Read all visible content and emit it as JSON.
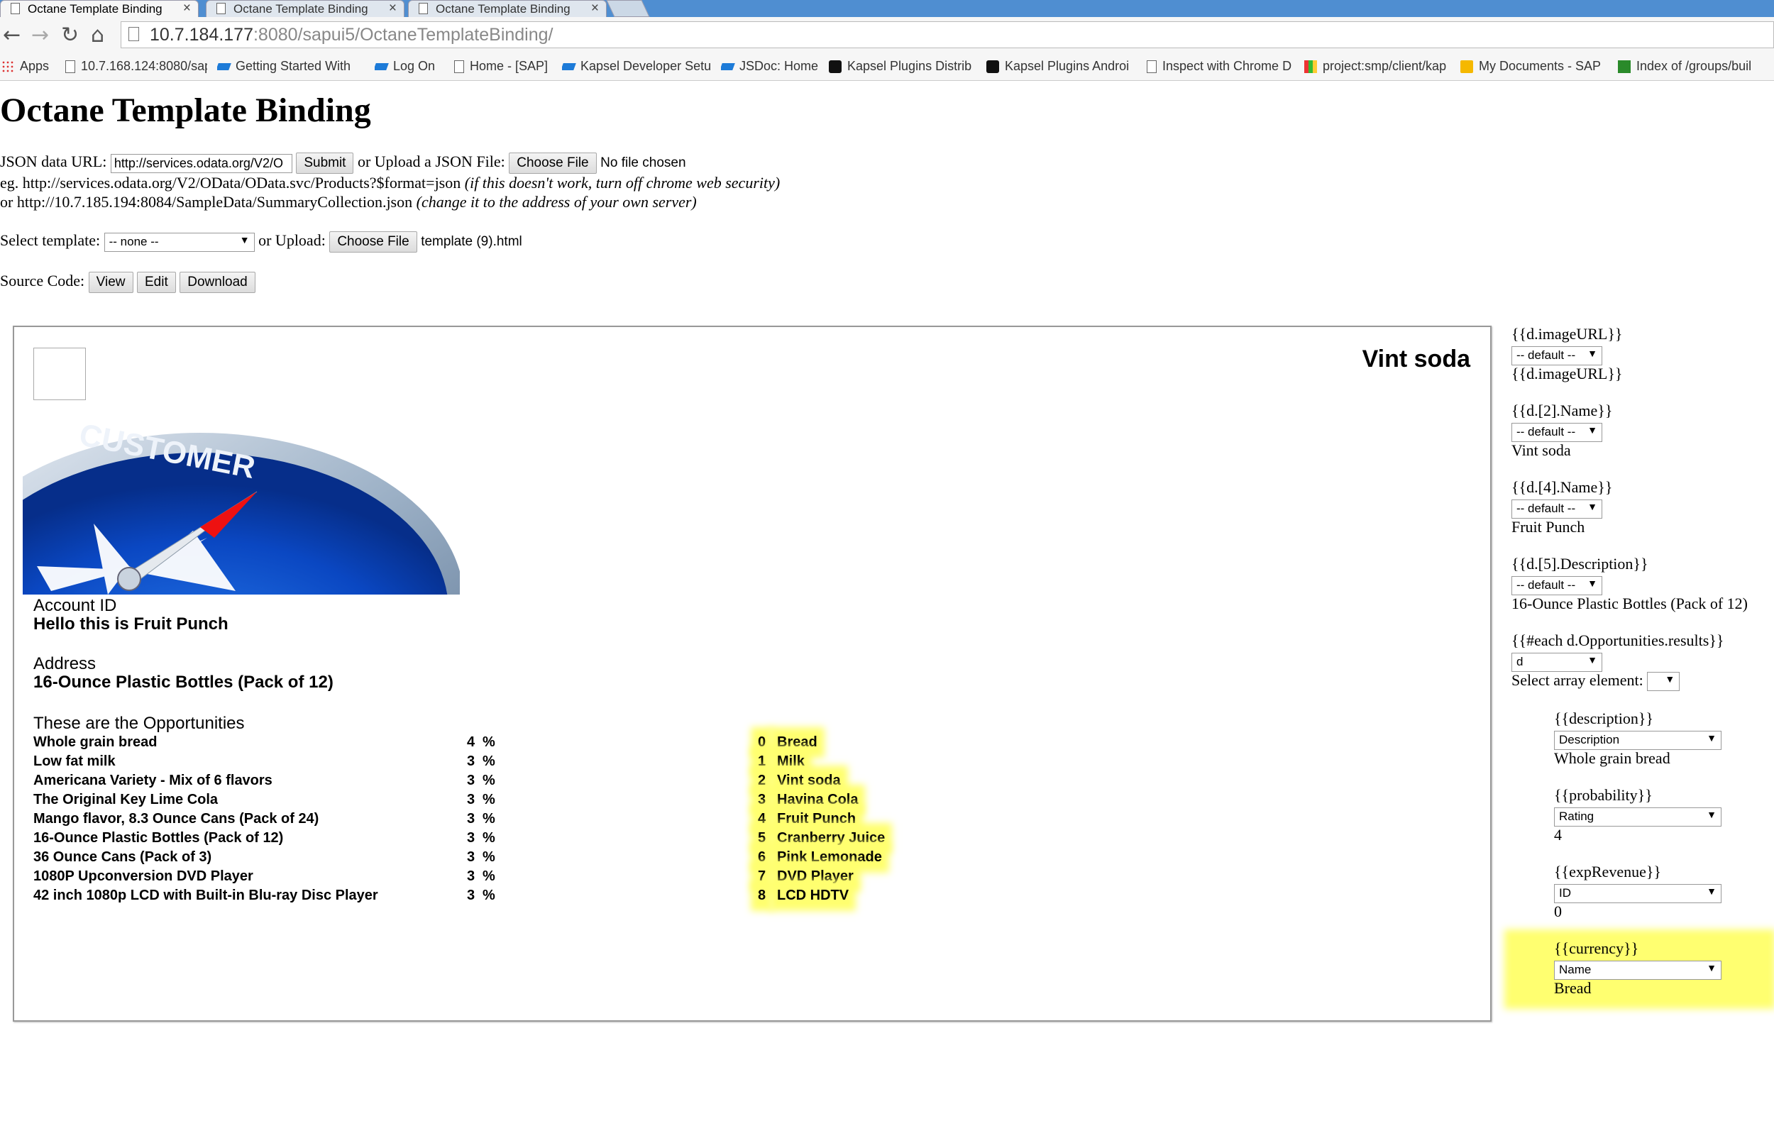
{
  "browser": {
    "tabs": [
      {
        "title": "Octane Template Binding",
        "close": "×"
      },
      {
        "title": "Octane Template Binding",
        "close": "×"
      },
      {
        "title": "Octane Template Binding",
        "close": "×"
      }
    ],
    "nav": {
      "back": "←",
      "forward": "→",
      "reload": "↻",
      "home": "⌂"
    },
    "url": {
      "host": "10.7.184.177",
      "rest": ":8080/sapui5/OctaneTemplateBinding/"
    },
    "bookmarks": [
      {
        "label": "Apps",
        "icon": "grid"
      },
      {
        "label": "10.7.168.124:8080/sap",
        "icon": "doc"
      },
      {
        "label": "Getting Started With",
        "icon": "sap"
      },
      {
        "label": "Log On",
        "icon": "sap"
      },
      {
        "label": "Home - [SAP]",
        "icon": "doc"
      },
      {
        "label": "Kapsel Developer Setu",
        "icon": "sap"
      },
      {
        "label": "JSDoc: Home",
        "icon": "sap"
      },
      {
        "label": "Kapsel Plugins Distrib",
        "icon": "git"
      },
      {
        "label": "Kapsel Plugins Androi",
        "icon": "git"
      },
      {
        "label": "Inspect with Chrome D",
        "icon": "doc"
      },
      {
        "label": "project:smp/client/kap",
        "icon": "pm"
      },
      {
        "label": "My Documents - SAP",
        "icon": "folder"
      },
      {
        "label": "Index of /groups/buil",
        "icon": "n"
      }
    ]
  },
  "page": {
    "title": "Octane Template Binding",
    "json_label": "JSON data URL:",
    "json_url": "http://services.odata.org/V2/O",
    "submit": "Submit",
    "upload_json_label": "or Upload a JSON File:",
    "choose_file": "Choose File",
    "no_file": "No file chosen",
    "eg_prefix": "eg. http://services.odata.org/V2/OData/OData.svc/Products?$format=json",
    "eg_note": "(if this doesn't work, turn off chrome web security)",
    "or_prefix": "or http://10.7.185.194:8084/SampleData/SummaryCollection.json",
    "or_note": "(change it to the address of your own server)",
    "select_template_label": "Select template:",
    "template_value": "-- none --",
    "or_upload": "or Upload:",
    "template_file": "template (9).html",
    "source_code_label": "Source Code:",
    "view": "View",
    "edit": "Edit",
    "download": "Download"
  },
  "preview": {
    "title": "Vint soda",
    "account_label": "Account ID",
    "account_value": "Hello this is Fruit Punch",
    "address_label": "Address",
    "address_value": "16-Ounce Plastic Bottles (Pack of 12)",
    "opps_label": "These are the Opportunities",
    "hero_text": "CUSTOMER",
    "opportunities": [
      {
        "description": "Whole grain bread",
        "probability": "4",
        "unit": "%",
        "index": "0",
        "name": "Bread"
      },
      {
        "description": "Low fat milk",
        "probability": "3",
        "unit": "%",
        "index": "1",
        "name": "Milk"
      },
      {
        "description": "Americana Variety - Mix of 6 flavors",
        "probability": "3",
        "unit": "%",
        "index": "2",
        "name": "Vint soda"
      },
      {
        "description": "The Original Key Lime Cola",
        "probability": "3",
        "unit": "%",
        "index": "3",
        "name": "Havina Cola"
      },
      {
        "description": "Mango flavor, 8.3 Ounce Cans (Pack of 24)",
        "probability": "3",
        "unit": "%",
        "index": "4",
        "name": "Fruit Punch"
      },
      {
        "description": "16-Ounce Plastic Bottles (Pack of 12)",
        "probability": "3",
        "unit": "%",
        "index": "5",
        "name": "Cranberry Juice"
      },
      {
        "description": "36 Ounce Cans (Pack of 3)",
        "probability": "3",
        "unit": "%",
        "index": "6",
        "name": "Pink Lemonade"
      },
      {
        "description": "1080P Upconversion DVD Player",
        "probability": "3",
        "unit": "%",
        "index": "7",
        "name": "DVD Player"
      },
      {
        "description": "42 inch 1080p LCD with Built-in Blu-ray Disc Player",
        "probability": "3",
        "unit": "%",
        "index": "8",
        "name": "LCD HDTV"
      }
    ]
  },
  "bindings": [
    {
      "tag": "{{d.imageURL}}",
      "select": "-- default --",
      "value": "{{d.imageURL}}"
    },
    {
      "tag": "{{d.[2].Name}}",
      "select": "-- default --",
      "value": "Vint soda"
    },
    {
      "tag": "{{d.[4].Name}}",
      "select": "-- default --",
      "value": "Fruit Punch"
    },
    {
      "tag": "{{d.[5].Description}}",
      "select": "-- default --",
      "value": "16-Ounce Plastic Bottles (Pack of 12)"
    },
    {
      "tag": "{{#each d.Opportunities.results}}",
      "select": "d",
      "array_label": "Select array element:",
      "array_value": ""
    },
    {
      "tag": "{{description}}",
      "select": "Description",
      "value": "Whole grain bread"
    },
    {
      "tag": "{{probability}}",
      "select": "Rating",
      "value": "4"
    },
    {
      "tag": "{{expRevenue}}",
      "select": "ID",
      "value": "0"
    },
    {
      "tag": "{{currency}}",
      "select": "Name",
      "value": "Bread"
    }
  ],
  "colors": {
    "highlight": "#ffff70",
    "tabbar": "#4f8ed1"
  }
}
